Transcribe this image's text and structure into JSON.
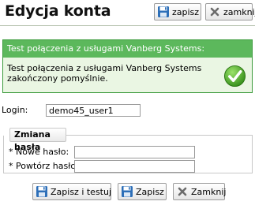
{
  "header": {
    "title": "Edycja konta",
    "save_label": "zapisz",
    "close_label": "zamknij"
  },
  "message": {
    "heading": "Test połączenia z usługami Vanberg Systems:",
    "body": "Test połączenia z usługami Vanberg Systems zakończony pomyślnie.",
    "icon": "success-check-icon",
    "status_color": "#5cb85c"
  },
  "form": {
    "login_label": "Login:",
    "login_value": "demo45_user1",
    "password_section_title": "Zmiana hasła",
    "new_password_label": "* Nowe hasło:",
    "new_password_value": "",
    "repeat_password_label": "* Powtórz hasło:",
    "repeat_password_value": ""
  },
  "footer": {
    "save_and_test_label": "Zapisz i testuj",
    "save_label": "Zapisz",
    "close_label": "Zamknij"
  }
}
